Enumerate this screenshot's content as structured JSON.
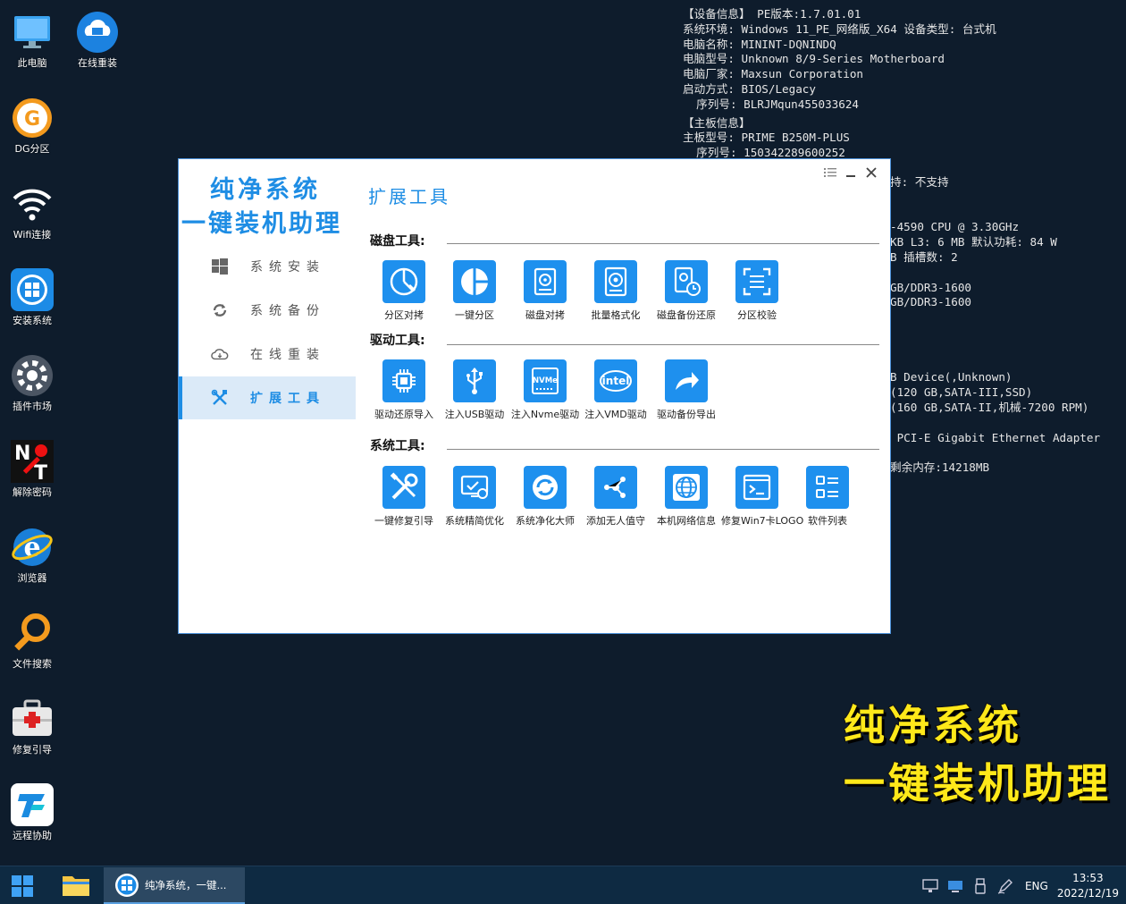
{
  "desktop": {
    "icons": [
      {
        "label": "此电脑",
        "icon": "computer-icon"
      },
      {
        "label": "在线重装",
        "icon": "online-reinstall-icon"
      },
      {
        "label": "DG分区",
        "icon": "dg-partition-icon"
      },
      {
        "label": "Wifi连接",
        "icon": "wifi-icon"
      },
      {
        "label": "安装系统",
        "icon": "install-system-icon"
      },
      {
        "label": "插件市场",
        "icon": "plugin-market-icon"
      },
      {
        "label": "解除密码",
        "icon": "remove-password-icon"
      },
      {
        "label": "浏览器",
        "icon": "browser-icon"
      },
      {
        "label": "文件搜索",
        "icon": "file-search-icon"
      },
      {
        "label": "修复引导",
        "icon": "repair-boot-icon"
      },
      {
        "label": "远程协助",
        "icon": "remote-assist-icon"
      }
    ]
  },
  "info_panel": {
    "lines": [
      "【设备信息】 PE版本:1.7.01.01",
      "系统环境: Windows 11_PE_网络版_X64 设备类型: 台式机",
      "电脑名称: MININT-DQNINDQ",
      "电脑型号: Unknown 8/9-Series Motherboard",
      "电脑厂家: Maxsun Corporation",
      "启动方式: BIOS/Legacy",
      "  序列号: BLRJMqun455033624",
      "【主板信息】",
      "主板型号: PRIME B250M-PLUS",
      "  序列号: 150342289600252"
    ],
    "right_lines": [
      "持: 不支持",
      "",
      "",
      "-4590 CPU @ 3.30GHz",
      "KB L3: 6 MB 默认功耗: 84 W",
      "B 插槽数: 2",
      "",
      "GB/DDR3-1600",
      "GB/DDR3-1600",
      "",
      "",
      "",
      "",
      "B Device(,Unknown)",
      "(120 GB,SATA-III,SSD)",
      "(160 GB,SATA-II,机械-7200 RPM)",
      "",
      " PCI-E Gigabit Ethernet Adapter",
      "",
      "剩余内存:14218MB"
    ]
  },
  "watermark": {
    "line1": "纯净系统",
    "line2": "一键装机助理"
  },
  "window": {
    "logo_line1": "纯净系统",
    "logo_line2": "一键装机助理",
    "page_title": "扩展工具",
    "nav": [
      {
        "label": "系统安装",
        "icon": "windows-icon",
        "active": false
      },
      {
        "label": "系统备份",
        "icon": "backup-icon",
        "active": false
      },
      {
        "label": "在线重装",
        "icon": "cloud-icon",
        "active": false
      },
      {
        "label": "扩展工具",
        "icon": "tools-icon",
        "active": true
      }
    ],
    "sections": [
      {
        "title": "磁盘工具:",
        "tools": [
          "分区对拷",
          "一键分区",
          "磁盘对拷",
          "批量格式化",
          "磁盘备份还原",
          "分区校验"
        ]
      },
      {
        "title": "驱动工具:",
        "tools": [
          "驱动还原导入",
          "注入USB驱动",
          "注入Nvme驱动",
          "注入VMD驱动",
          "驱动备份导出"
        ]
      },
      {
        "title": "系统工具:",
        "tools": [
          "一键修复引导",
          "系统精简优化",
          "系统净化大师",
          "添加无人值守",
          "本机网络信息",
          "修复Win7卡LOGO",
          "软件列表"
        ]
      }
    ]
  },
  "taskbar": {
    "task_label": "纯净系统，一键...",
    "lang": "ENG",
    "time": "13:53",
    "date": "2022/12/19"
  },
  "colors": {
    "accent": "#1e8de4",
    "desktop_bg": "#0e1c2c",
    "taskbar_bg": "#0e2a42",
    "watermark": "#ffe81a"
  }
}
